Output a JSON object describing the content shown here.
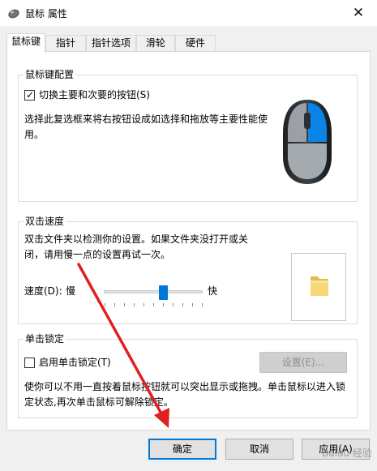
{
  "window": {
    "title": "鼠标 属性",
    "icon": "mouse-icon",
    "close_glyph": "✕"
  },
  "tabs": [
    {
      "label": "鼠标键",
      "active": true
    },
    {
      "label": "指针",
      "active": false
    },
    {
      "label": "指针选项",
      "active": false
    },
    {
      "label": "滑轮",
      "active": false
    },
    {
      "label": "硬件",
      "active": false
    }
  ],
  "button_config": {
    "title": "鼠标键配置",
    "switch_label": "切换主要和次要的按钮(S)",
    "switch_checked": true,
    "description": "选择此复选框来将右按钮设成如选择和拖放等主要性能使用。",
    "mouse_image": "mouse-illustration-icon",
    "accent": "#0a84e6"
  },
  "double_click": {
    "title": "双击速度",
    "description": "双击文件夹以检测你的设置。如果文件夹没打开或关闭，请用慢一点的设置再试一次。",
    "speed_label": "速度(D):",
    "slow_label": "慢",
    "fast_label": "快",
    "speed_value": 0.6,
    "folder_icon": "folder-icon"
  },
  "click_lock": {
    "title": "单击锁定",
    "enable_label": "启用单击锁定(T)",
    "enable_checked": false,
    "settings_label": "设置(E)...",
    "description": "使你可以不用一直按着鼠标按钮就可以突出显示或拖拽。单击鼠标以进入锁定状态,再次单击鼠标可解除锁定。"
  },
  "footer": {
    "ok_label": "确定",
    "cancel_label": "取消",
    "apply_label": "应用(A)"
  },
  "overlay": {
    "arrow_color": "#e02020",
    "watermark": "Baidu 经验"
  },
  "colors": {
    "accent": "#0078d7"
  }
}
